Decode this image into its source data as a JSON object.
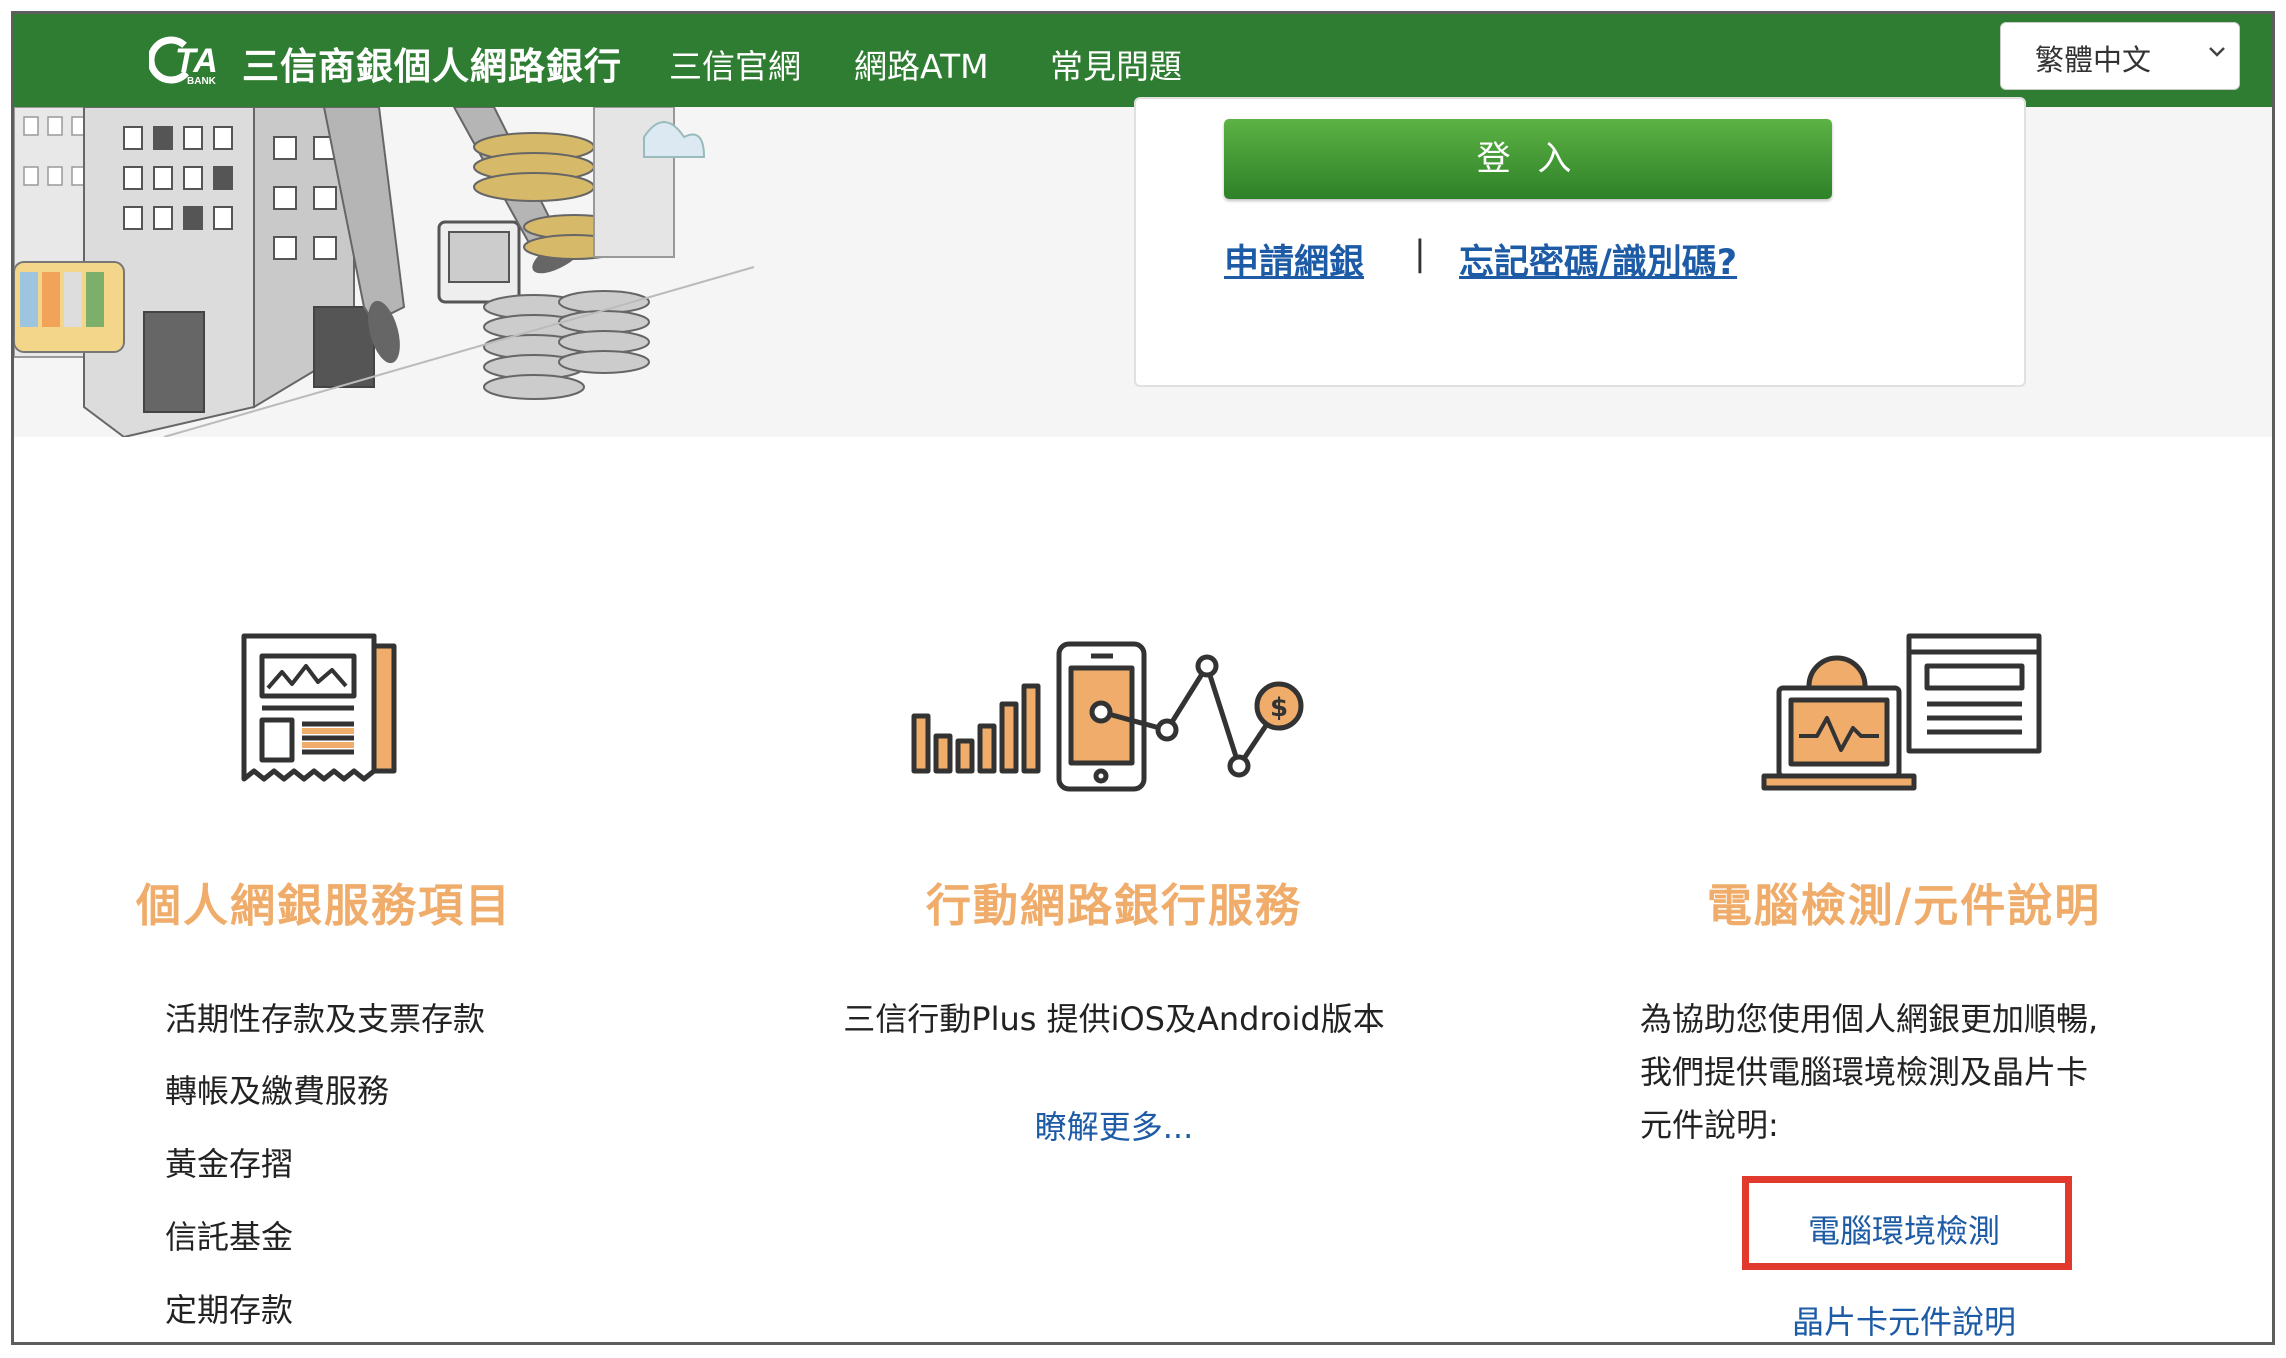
{
  "navbar": {
    "logo_text": "CTA BANK",
    "brand": "三信商銀個人網路銀行",
    "links": [
      "三信官網",
      "網路ATM",
      "常見問題"
    ],
    "language_selected": "繁體中文"
  },
  "login": {
    "button_label": "登 入",
    "apply_link": "申請網銀",
    "separator": "|",
    "forgot_link": "忘記密碼/識別碼?"
  },
  "features": [
    {
      "title": "個人網銀服務項目",
      "icon": "newspaper-chart-icon",
      "items": [
        "活期性存款及支票存款",
        "轉帳及繳費服務",
        "黃金存摺",
        "信託基金",
        "定期存款"
      ]
    },
    {
      "title": "行動網路銀行服務",
      "icon": "mobile-chart-icon",
      "description": "三信行動Plus 提供iOS及Android版本",
      "link": "瞭解更多..."
    },
    {
      "title": "電腦檢測/元件說明",
      "icon": "computer-settings-icon",
      "description_lines": [
        "為協助您使用個人網銀更加順暢,",
        "我們提供電腦環境檢測及晶片卡",
        "元件說明:"
      ],
      "links": [
        "電腦環境檢測",
        "晶片卡元件說明"
      ]
    }
  ],
  "colors": {
    "nav_green": "#2f7d32",
    "accent_orange": "#efac6a",
    "link_blue": "#1e5ba6",
    "highlight_red": "#e1392c"
  }
}
